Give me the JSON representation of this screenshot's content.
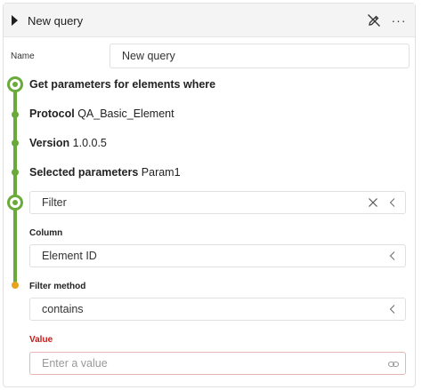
{
  "header": {
    "title": "New query",
    "expand_icon": "caret-right-icon",
    "edit_icon": "edit-off-icon",
    "more_icon": "more-icon",
    "more_glyph": "···"
  },
  "name": {
    "label": "Name",
    "value": "New query"
  },
  "steps": {
    "title": "Get parameters for elements where",
    "protocol_label": "Protocol",
    "protocol_value": "QA_Basic_Element",
    "version_label": "Version",
    "version_value": "1.0.0.5",
    "selected_label": "Selected parameters",
    "selected_value": "Param1"
  },
  "filter": {
    "value": "Filter",
    "column_label": "Column",
    "column_value": "Element ID",
    "method_label": "Filter method",
    "method_value": "contains",
    "value_label": "Value",
    "value_placeholder": "Enter a value"
  },
  "colors": {
    "timeline_green": "#6aaa3a",
    "pending_orange": "#e8a21c",
    "required_red": "#c21b1b"
  }
}
